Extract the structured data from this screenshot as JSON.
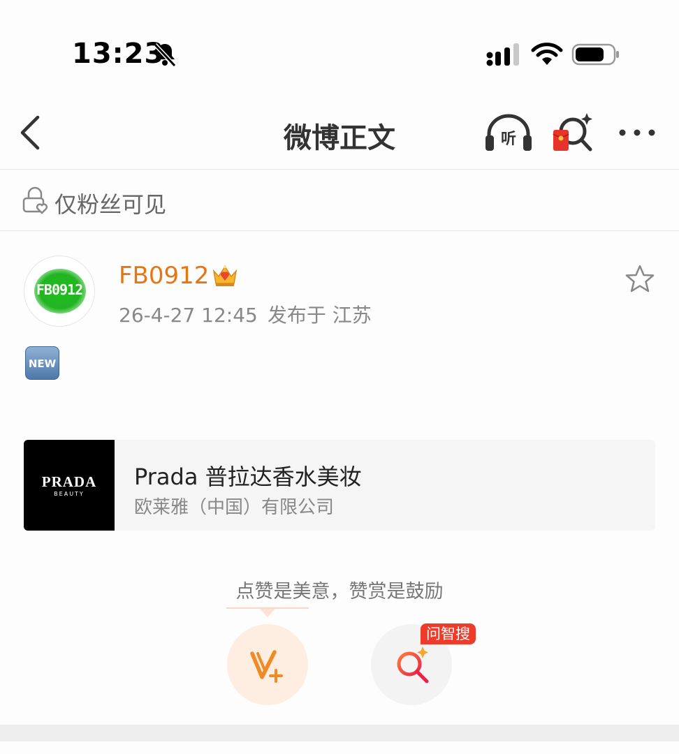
{
  "status_bar": {
    "time": "13:23",
    "icons": [
      "bell-muted-icon",
      "signal-icon",
      "wifi-icon",
      "battery-icon"
    ]
  },
  "nav": {
    "title": "微博正文",
    "listen_label": "听",
    "icons": [
      "back-icon",
      "listen-icon",
      "red-packet-search-icon",
      "more-icon"
    ]
  },
  "visibility": {
    "label": "仅粉丝可见"
  },
  "post": {
    "author_name": "FB0912",
    "avatar_text": "FB0912",
    "timestamp": "26-4-27 12:45",
    "location": "发布于 江苏",
    "badge": "NEW",
    "colors": {
      "author_name": "#e8750f"
    }
  },
  "brand_card": {
    "logo_main": "PRADA",
    "logo_sub": "BEAUTY",
    "name": "Prada 普拉达香水美妆",
    "company": "欧莱雅（中国）有限公司"
  },
  "reward": {
    "hint": "点赞是美意，赞赏是鼓励",
    "ai_badge": "问智搜",
    "colors": {
      "reward": "#f08a24",
      "ai_badge": "#ee3b2a"
    }
  }
}
